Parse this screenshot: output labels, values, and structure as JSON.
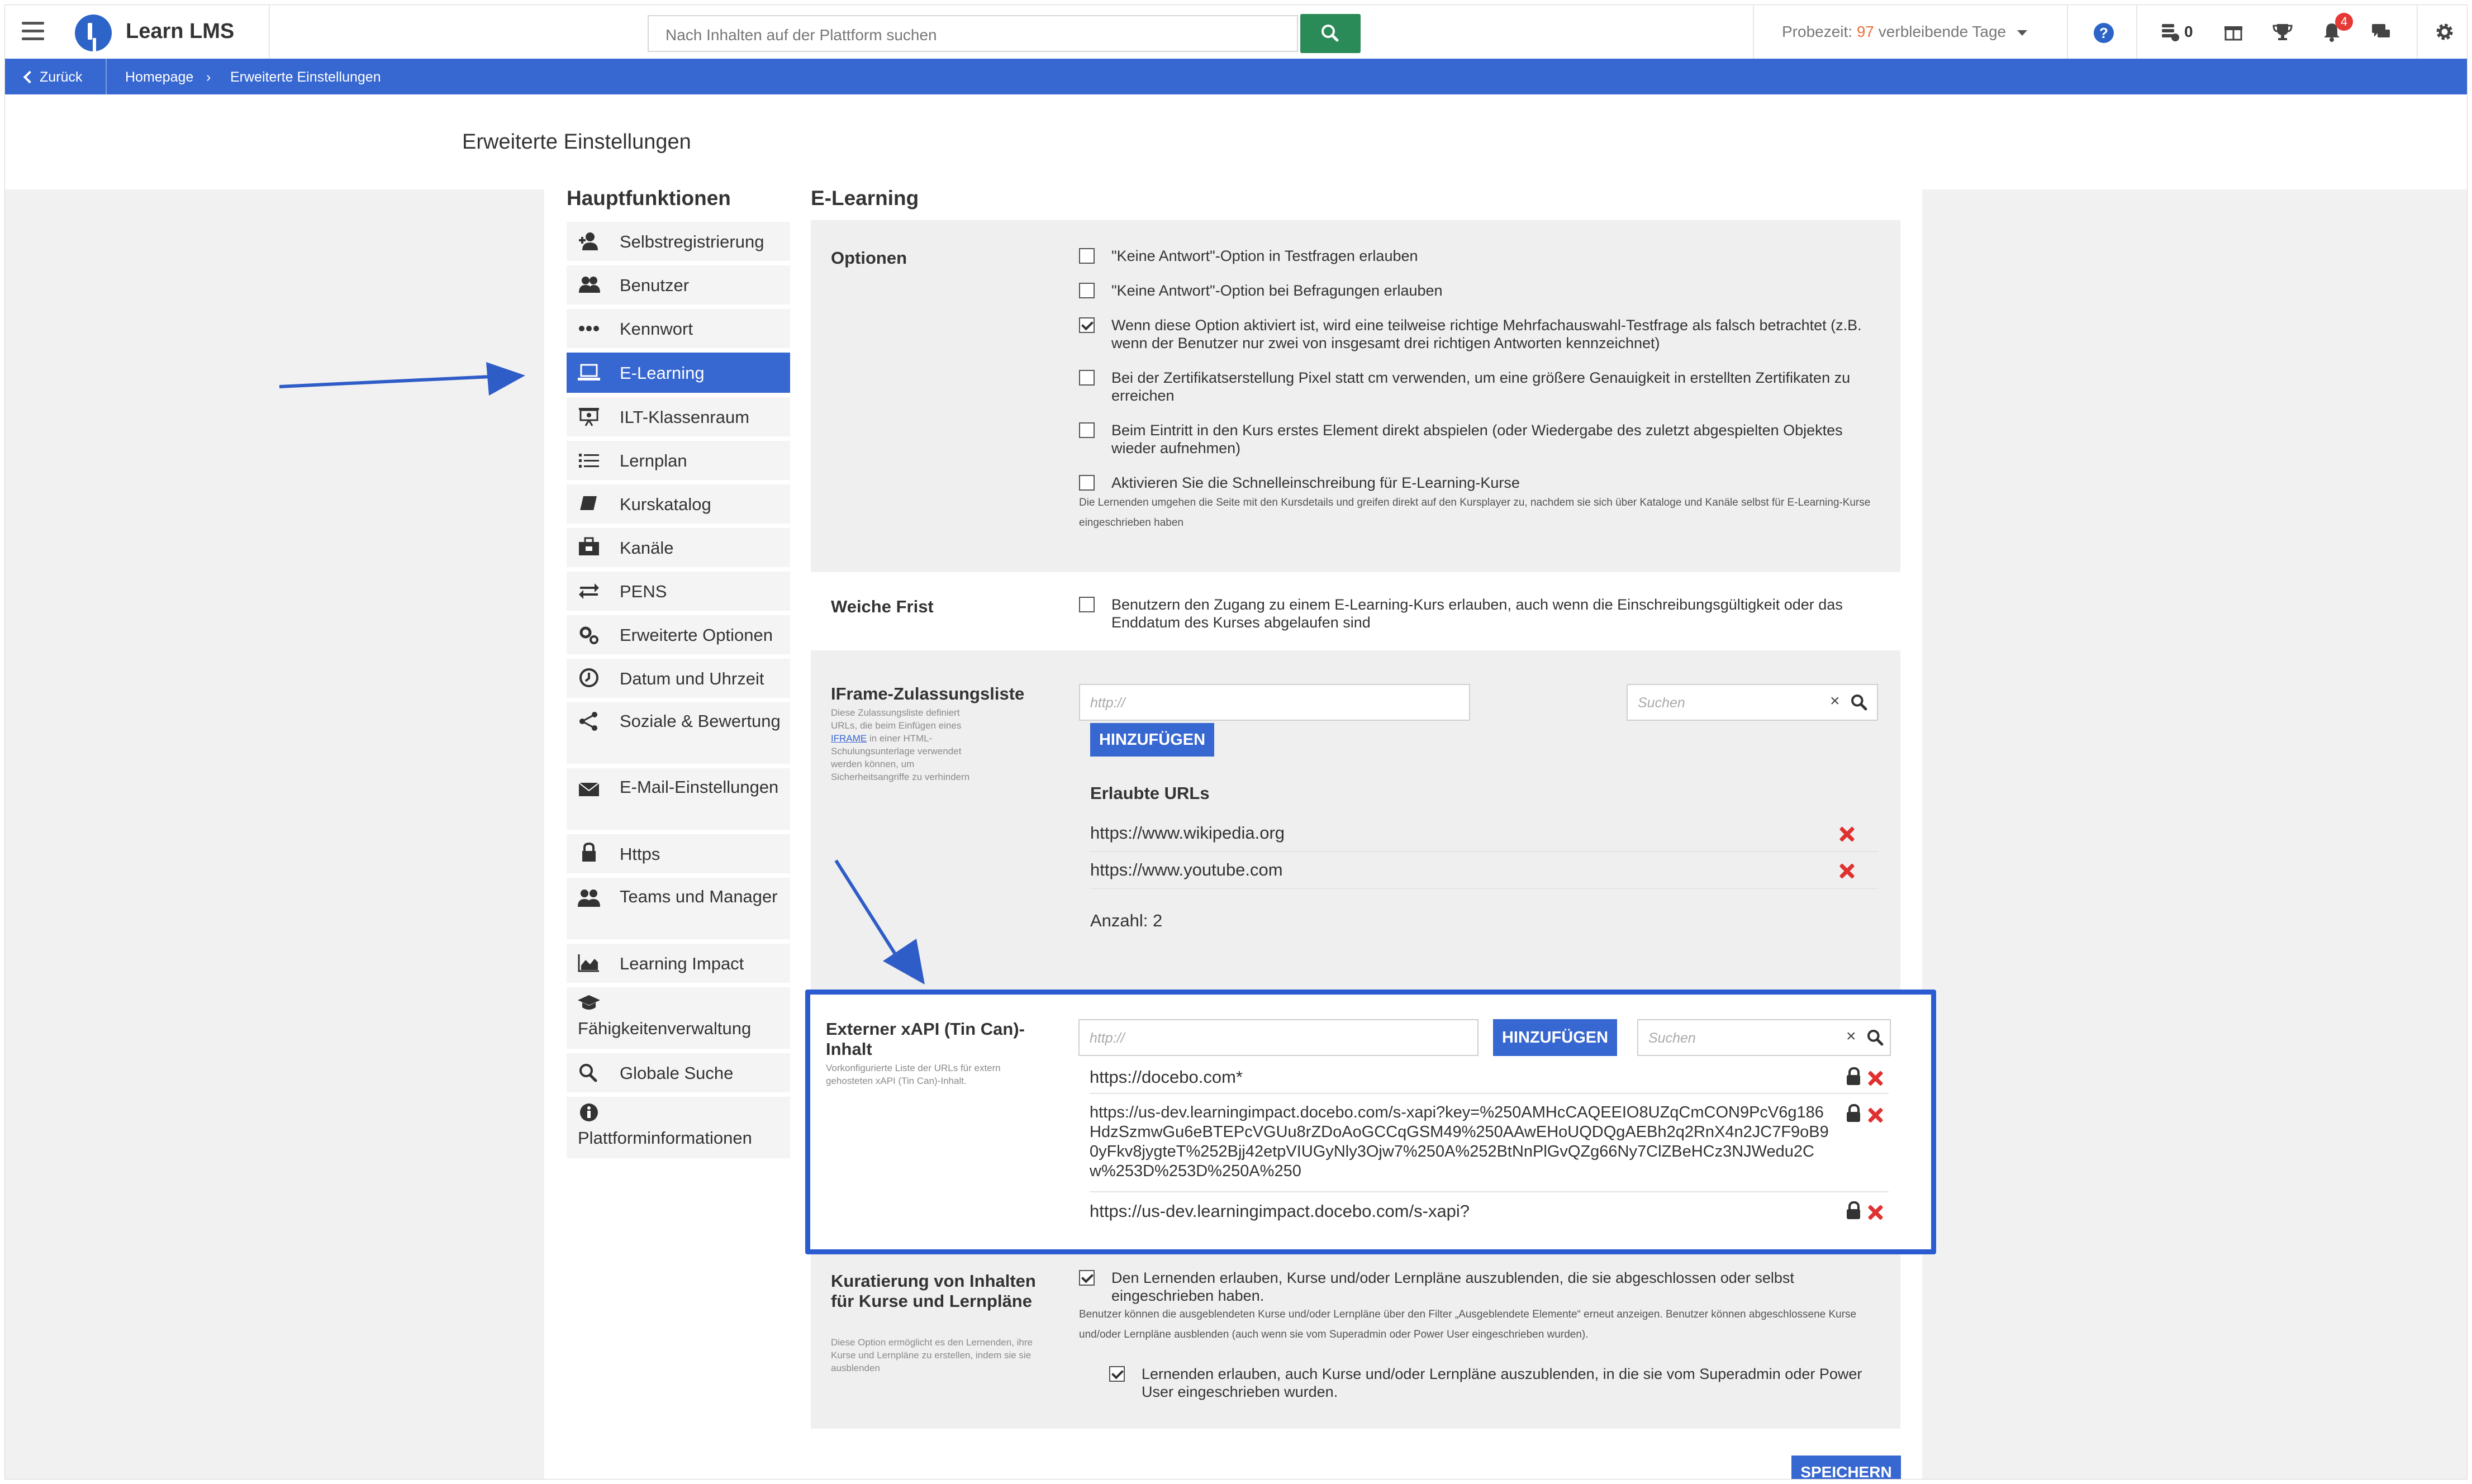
{
  "topbar": {
    "app_name": "Learn LMS",
    "search_placeholder": "Nach Inhalten auf der Plattform suchen",
    "trial_prefix": "Probezeit:",
    "trial_days": "97",
    "trial_suffix": "verbleibende Tage",
    "coins_count": "0",
    "notification_count": "4",
    "accent_color": "#3767d0",
    "search_button_color": "#2a8a58"
  },
  "breadcrumb": {
    "back_label": "Zurück",
    "home_label": "Homepage",
    "current_label": "Erweiterte Einstellungen"
  },
  "page": {
    "title": "Erweiterte Einstellungen"
  },
  "sidebar": {
    "title": "Hauptfunktionen",
    "items": [
      {
        "label": "Selbstregistrierung",
        "icon": "user-plus-icon"
      },
      {
        "label": "Benutzer",
        "icon": "users-icon"
      },
      {
        "label": "Kennwort",
        "icon": "dots-icon"
      },
      {
        "label": "E-Learning",
        "icon": "laptop-icon",
        "active": true
      },
      {
        "label": "ILT-Klassenraum",
        "icon": "presentation-icon"
      },
      {
        "label": "Lernplan",
        "icon": "list-icon"
      },
      {
        "label": "Kurskatalog",
        "icon": "book-icon"
      },
      {
        "label": "Kanäle",
        "icon": "briefcase-icon"
      },
      {
        "label": "PENS",
        "icon": "exchange-icon"
      },
      {
        "label": "Erweiterte Optionen",
        "icon": "gears-icon"
      },
      {
        "label": "Datum und Uhrzeit",
        "icon": "clock-icon"
      },
      {
        "label": "Soziale & Bewertung",
        "icon": "share-icon"
      },
      {
        "label": "E-Mail-Einstellungen",
        "icon": "envelope-icon"
      },
      {
        "label": "Https",
        "icon": "lock-icon"
      },
      {
        "label": "Teams und Manager",
        "icon": "team-icon"
      },
      {
        "label": "Learning Impact",
        "icon": "area-chart-icon"
      },
      {
        "label": "Fähigkeitenverwaltung",
        "icon": "graduation-cap-icon"
      },
      {
        "label": "Globale Suche",
        "icon": "search-icon"
      },
      {
        "label": "Plattforminformationen",
        "icon": "info-icon"
      }
    ]
  },
  "main": {
    "title": "E-Learning",
    "options_label": "Optionen",
    "options": [
      {
        "text": "\"Keine Antwort\"-Option in Testfragen erlauben",
        "checked": false
      },
      {
        "text": "\"Keine Antwort\"-Option bei Befragungen erlauben",
        "checked": false
      },
      {
        "text": "Wenn diese Option aktiviert ist, wird eine teilweise richtige Mehrfachauswahl-Testfrage als falsch betrachtet (z.B. wenn der Benutzer nur zwei von insgesamt drei richtigen Antworten kennzeichnet)",
        "checked": true
      },
      {
        "text": "Bei der Zertifikatserstellung Pixel statt cm verwenden, um eine größere Genauigkeit in erstellten Zertifikaten zu erreichen",
        "checked": false
      },
      {
        "text": "Beim Eintritt in den Kurs erstes Element direkt abspielen (oder Wiedergabe des zuletzt abgespielten Objektes wieder aufnehmen)",
        "checked": false
      },
      {
        "text": "Aktivieren Sie die Schnelleinschreibung für E-Learning-Kurse",
        "checked": false,
        "note": "Die Lernenden umgehen die Seite mit den Kursdetails und greifen direkt auf den Kursplayer zu, nachdem sie sich über Kataloge und Kanäle selbst für E-Learning-Kurse eingeschrieben haben"
      }
    ],
    "grace": {
      "label": "Weiche Frist",
      "text": "Benutzern den Zugang zu einem E-Learning-Kurs erlauben, auch wenn die Einschreibungsgültigkeit oder das Enddatum des Kurses abgelaufen sind",
      "checked": false
    },
    "iframe": {
      "label": "IFrame-Zulassungsliste",
      "desc_pre": "Diese Zulassungsliste definiert URLs, die beim Einfügen eines",
      "desc_link": "IFRAME",
      "desc_post": "in einer HTML-Schulungsunterlage verwendet werden können, um Sicherheitsangriffe zu verhindern",
      "url_placeholder": "http://",
      "add_label": "HINZUFÜGEN",
      "search_placeholder": "Suchen",
      "allowed_title": "Erlaubte URLs",
      "urls": [
        "https://www.wikipedia.org",
        "https://www.youtube.com"
      ],
      "count_label": "Anzahl: 2"
    },
    "xapi": {
      "label": "Externer xAPI (Tin Can)-Inhalt",
      "desc": "Vorkonfigurierte Liste der URLs für extern gehosteten xAPI (Tin Can)-Inhalt.",
      "url_placeholder": "http://",
      "add_label": "HINZUFÜGEN",
      "search_placeholder": "Suchen",
      "urls": [
        "https://docebo.com*",
        "https://us-dev.learningimpact.docebo.com/s-xapi?key=%250AMHcCAQEEIO8UZqCmCON9PcV6g186HdzSzmwGu6eBTEPcVGUu8rZDoAoGCCqGSM49%250AAwEHoUQDQgAEBh2q2RnX4n2JC7F9oB90yFkv8jygteT%252Bjj42etpVIUGyNly3Ojw7%250A%252BtNnPlGvQZg66Ny7ClZBeHCz3NJWedu2Cw%253D%253D%250A%250",
        "https://us-dev.learningimpact.docebo.com/s-xapi?"
      ],
      "highlight_color": "#2b5bd1"
    },
    "curation": {
      "label": "Kuratierung von Inhalten für Kurse und Lernpläne",
      "desc": "Diese Option ermöglicht es den Lernenden, ihre Kurse und Lernpläne zu erstellen, indem sie sie ausblenden",
      "option1": "Den Lernenden erlauben, Kurse und/oder Lernpläne auszublenden, die sie abgeschlossen oder selbst eingeschrieben haben.",
      "note": "Benutzer können die ausgeblendeten Kurse und/oder Lernpläne über den Filter „Ausgeblendete Elemente“ erneut anzeigen. Benutzer können abgeschlossene Kurse und/oder Lernpläne ausblenden (auch wenn sie vom Superadmin oder Power User eingeschrieben wurden).",
      "option2": "Lernenden erlauben, auch Kurse und/oder Lernpläne auszublenden, in die sie vom Superadmin oder Power User eingeschrieben wurden.",
      "option1_checked": true,
      "option2_checked": true
    },
    "save_label": "SPEICHERN"
  }
}
